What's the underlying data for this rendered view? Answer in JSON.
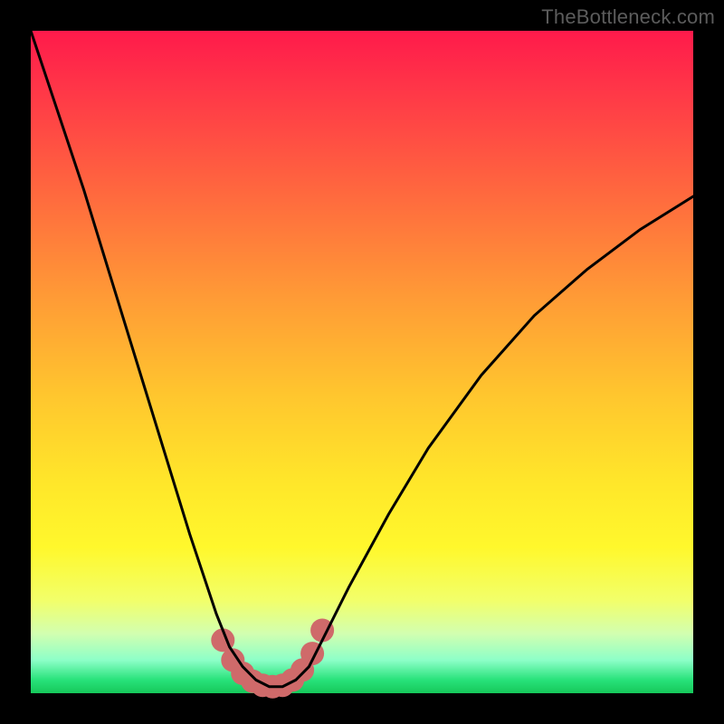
{
  "watermark": "TheBottleneck.com",
  "chart_data": {
    "type": "line",
    "title": "",
    "xlabel": "",
    "ylabel": "",
    "xlim": [
      0,
      1
    ],
    "ylim": [
      0,
      1
    ],
    "series": [
      {
        "name": "bottleneck-curve",
        "x": [
          0.0,
          0.04,
          0.08,
          0.12,
          0.16,
          0.2,
          0.24,
          0.28,
          0.3,
          0.32,
          0.34,
          0.36,
          0.38,
          0.4,
          0.42,
          0.44,
          0.48,
          0.54,
          0.6,
          0.68,
          0.76,
          0.84,
          0.92,
          1.0
        ],
        "y": [
          1.0,
          0.88,
          0.76,
          0.63,
          0.5,
          0.37,
          0.24,
          0.12,
          0.07,
          0.04,
          0.02,
          0.01,
          0.01,
          0.02,
          0.04,
          0.08,
          0.16,
          0.27,
          0.37,
          0.48,
          0.57,
          0.64,
          0.7,
          0.75
        ]
      },
      {
        "name": "highlight-dots",
        "x": [
          0.29,
          0.305,
          0.32,
          0.335,
          0.35,
          0.365,
          0.38,
          0.395,
          0.41,
          0.425,
          0.44
        ],
        "y": [
          0.08,
          0.05,
          0.03,
          0.018,
          0.012,
          0.01,
          0.012,
          0.02,
          0.035,
          0.06,
          0.095
        ]
      }
    ],
    "colors": {
      "curve": "#000000",
      "dots": "#cf6a6a",
      "gradient_top": "#ff1a4b",
      "gradient_bottom": "#16c85a"
    }
  }
}
